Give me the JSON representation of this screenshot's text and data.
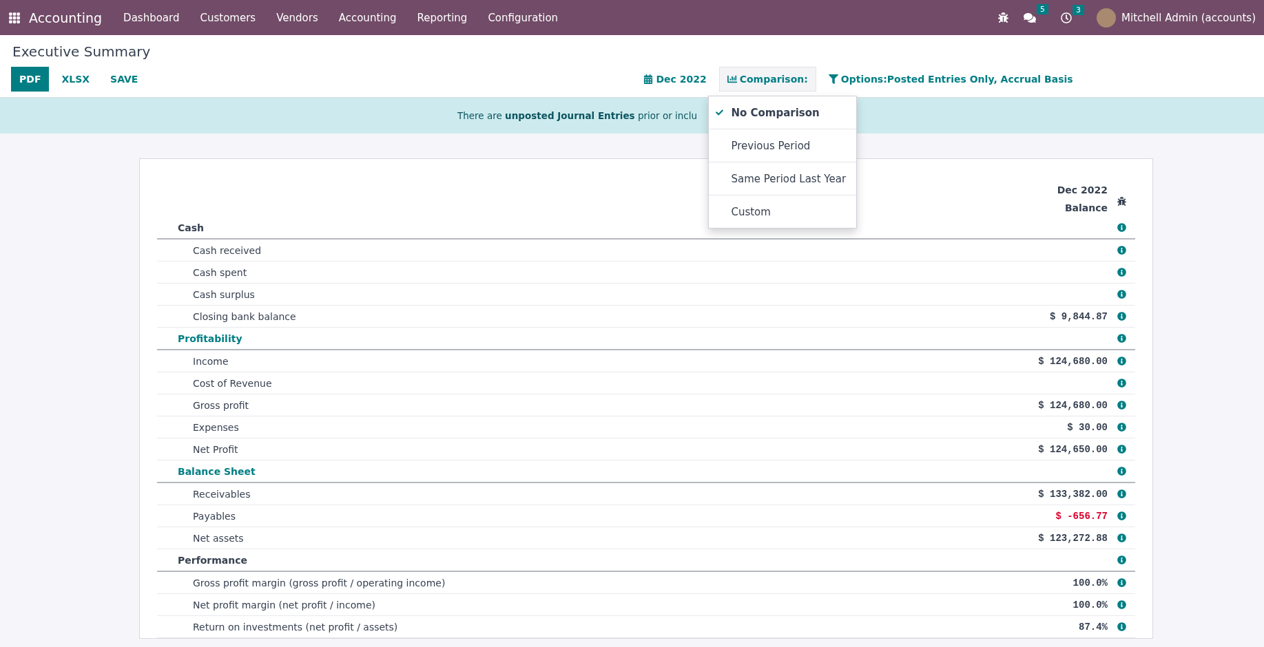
{
  "navbar": {
    "app_name": "Accounting",
    "menu": [
      "Dashboard",
      "Customers",
      "Vendors",
      "Accounting",
      "Reporting",
      "Configuration"
    ],
    "messages_count": "5",
    "activities_count": "3",
    "user": "Mitchell Admin (accounts)"
  },
  "page": {
    "title": "Executive Summary",
    "buttons": [
      {
        "label": "PDF",
        "primary": true
      },
      {
        "label": "XLSX",
        "primary": false
      },
      {
        "label": "SAVE",
        "primary": false
      }
    ],
    "filters": [
      {
        "kind": "date",
        "label": "Dec 2022",
        "open": false
      },
      {
        "kind": "comparison",
        "label": "Comparison:",
        "open": true
      },
      {
        "kind": "options",
        "label": "Options:Posted Entries Only, Accrual Basis",
        "open": false
      }
    ]
  },
  "alert": "There are **unposted Journal Entries** prior or inclu",
  "comparison_menu": [
    {
      "label": "No Comparison",
      "selected": true
    },
    {
      "label": "Previous Period",
      "selected": false
    },
    {
      "label": "Same Period Last Year",
      "selected": false
    },
    {
      "label": "Custom",
      "selected": false
    }
  ],
  "report": {
    "column_header": [
      "Dec 2022",
      "Balance"
    ],
    "sections": [
      {
        "name": "Cash",
        "color": "#374151",
        "rows": [
          {
            "name": "Cash received"
          },
          {
            "name": "Cash spent"
          },
          {
            "name": "Cash surplus"
          },
          {
            "name": "Closing bank balance",
            "value": "$ 9,844.87",
            "negative": false
          }
        ]
      },
      {
        "name": "Profitability",
        "color": "#017e84",
        "rows": [
          {
            "name": "Income",
            "value": "$ 124,680.00",
            "negative": false
          },
          {
            "name": "Cost of Revenue"
          },
          {
            "name": "Gross profit",
            "value": "$ 124,680.00",
            "negative": false
          },
          {
            "name": "Expenses",
            "value": "$ 30.00",
            "negative": false
          },
          {
            "name": "Net Profit",
            "value": "$ 124,650.00",
            "negative": false
          }
        ]
      },
      {
        "name": "Balance Sheet",
        "color": "#017e84",
        "rows": [
          {
            "name": "Receivables",
            "value": "$ 133,382.00",
            "negative": false
          },
          {
            "name": "Payables",
            "value": "$ -656.77",
            "negative": true
          },
          {
            "name": "Net assets",
            "value": "$ 123,272.88",
            "negative": false
          }
        ]
      },
      {
        "name": "Performance",
        "color": "#374151",
        "rows": [
          {
            "name": "Gross profit margin (gross profit / operating income)",
            "value": "100.0%",
            "negative": false
          },
          {
            "name": "Net profit margin (net profit / income)",
            "value": "100.0%",
            "negative": false
          },
          {
            "name": "Return on investments (net profit / assets)",
            "value": "87.4%",
            "negative": false
          }
        ]
      }
    ]
  }
}
